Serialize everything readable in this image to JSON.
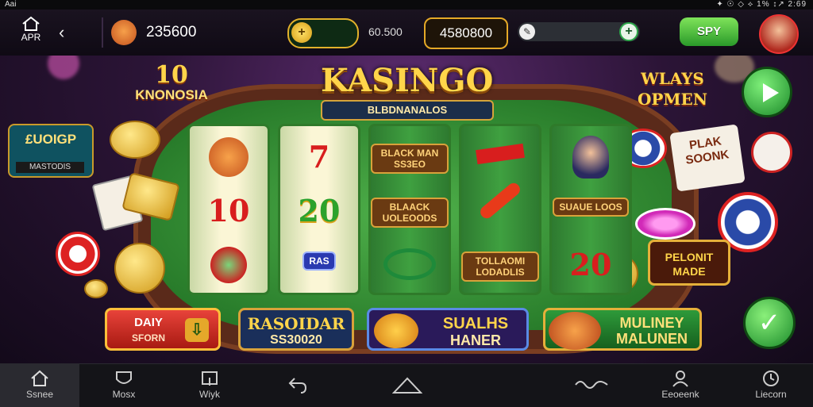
{
  "status_bar": {
    "left": "Aai",
    "right": "✦ ☉ ◇ ⟡ 1% ↕↗ 2:69"
  },
  "top_bar": {
    "home_label": "APR",
    "back_icon": "chevron-left-icon",
    "balance": "235600",
    "coin_value": "60.500",
    "gold_balance": "4580800",
    "spy_label": "SPY",
    "colors": {
      "accent_green": "#2a9a2a",
      "gold": "#e5a927"
    }
  },
  "game": {
    "title": "KASINGO",
    "subtitle": "BLBDNANALOS",
    "top_left_number": "10",
    "top_left_text": "KNONOSIA",
    "left_panel_title": "£UOIGP",
    "left_panel_sub": "MASTODIS",
    "ways_line1": "WLAYS",
    "ways_line2": "OPMEN",
    "card_line1": "PLAK",
    "card_line2": "SOONK",
    "machine_line1": "PELONIT",
    "machine_line2": "MADE",
    "reels": [
      {
        "symbols": [
          "fox-icon",
          "10",
          "cherry-icon"
        ]
      },
      {
        "symbols": [
          "7",
          "20",
          "RAS"
        ]
      },
      {
        "symbols": [
          "BLACK MAN SS3EO",
          "BLAACK UOLEOODS",
          "emerald-icon"
        ]
      },
      {
        "symbols": [
          "bar-icon",
          "feather-icon",
          "TOLLAOMI LODADLIS"
        ]
      },
      {
        "symbols": [
          "joker-icon",
          "SUAUE LOOS",
          "20"
        ]
      }
    ]
  },
  "bottom_buttons": [
    {
      "line1": "DAIY",
      "line2": "SFORN"
    },
    {
      "line1": "RASOIDAR",
      "line2": "SS30020"
    },
    {
      "line1": "SUALHS",
      "line2": "HANER"
    },
    {
      "line1": "MULINEY",
      "line2": "MALUNEN"
    }
  ],
  "nav_bar": [
    {
      "label": "Ssnee",
      "icon": "home-icon",
      "active": true
    },
    {
      "label": "Mosx",
      "icon": "mask-icon",
      "active": false
    },
    {
      "label": "Wiyk",
      "icon": "window-icon",
      "active": false
    },
    {
      "label": "",
      "icon": "back-arrow-icon",
      "active": false
    },
    {
      "label": "",
      "icon": "home-outline-icon",
      "active": false
    },
    {
      "label": "",
      "icon": "squiggle-icon",
      "active": false
    },
    {
      "label": "Eeoeenk",
      "icon": "person-icon",
      "active": false
    },
    {
      "label": "Liecorn",
      "icon": "clock-icon",
      "active": false
    }
  ]
}
